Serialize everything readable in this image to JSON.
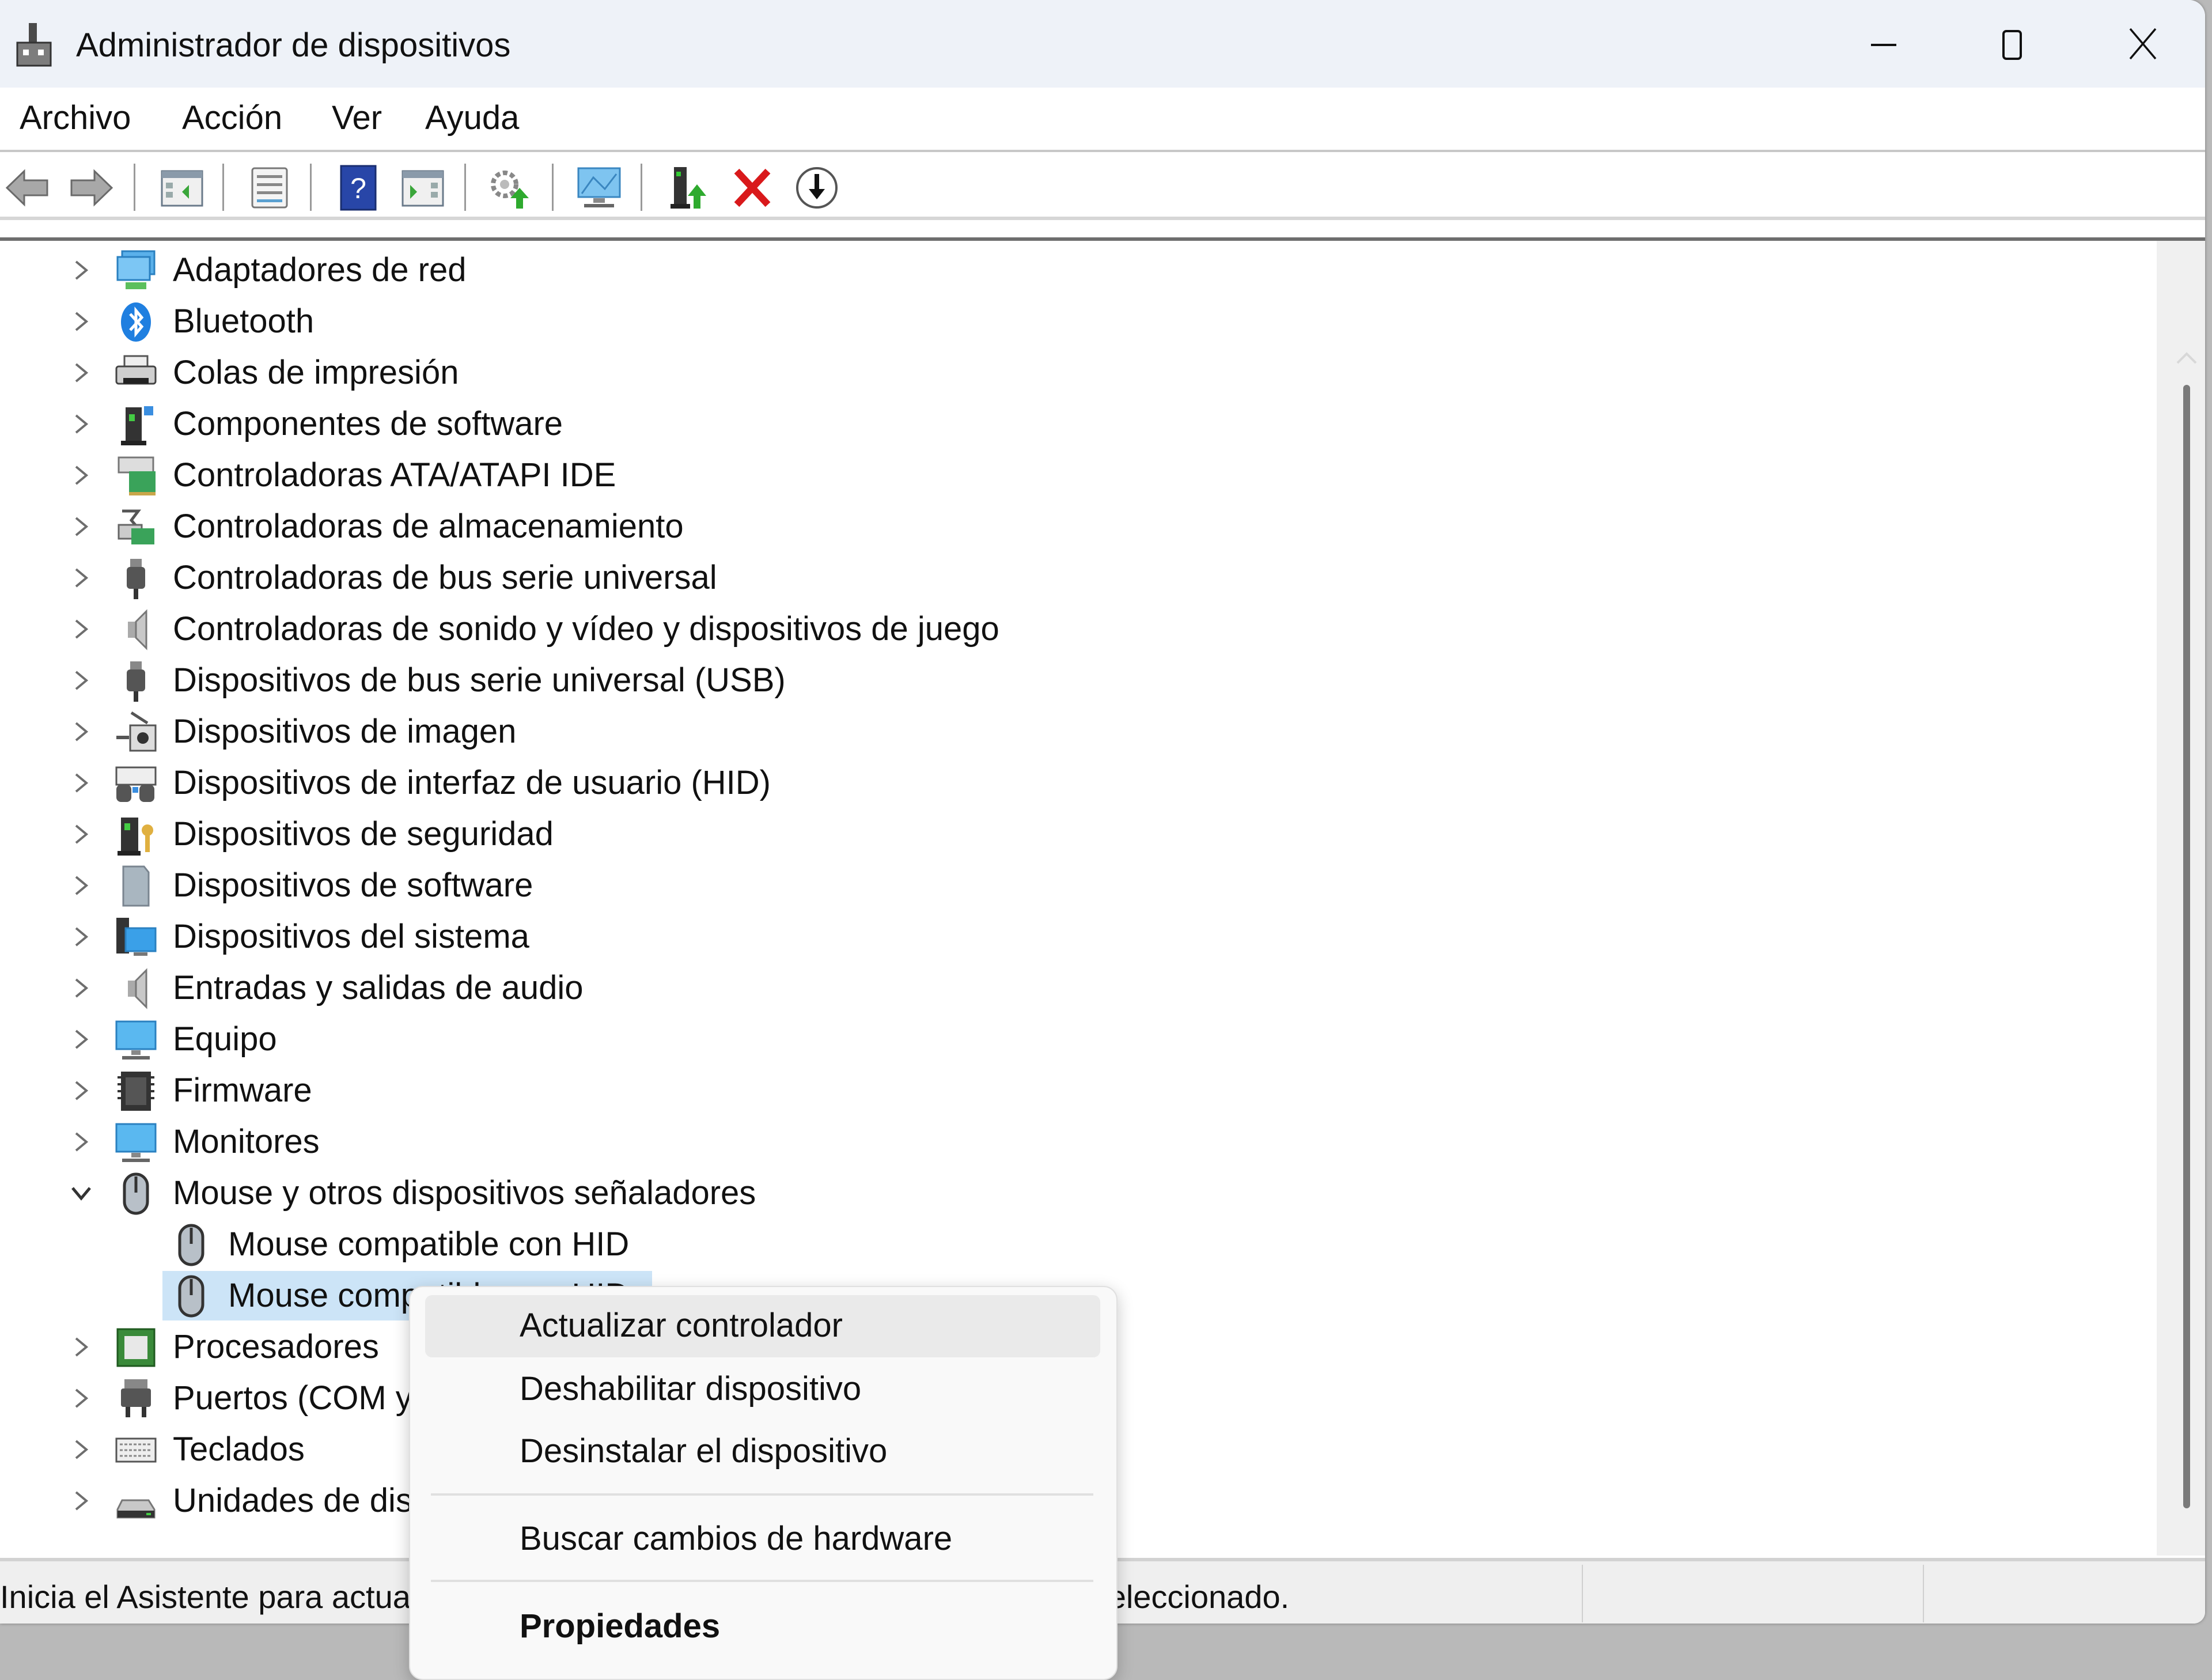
{
  "window": {
    "title": "Administrador de dispositivos",
    "controls": {
      "minimize": "minimize",
      "maximize": "maximize",
      "close": "close"
    }
  },
  "menubar": {
    "items": [
      {
        "label": "Archivo"
      },
      {
        "label": "Acción"
      },
      {
        "label": "Ver"
      },
      {
        "label": "Ayuda"
      }
    ]
  },
  "toolbar": {
    "buttons": [
      {
        "icon": "back-arrow-icon",
        "tooltip": "Atrás"
      },
      {
        "icon": "forward-arrow-icon",
        "tooltip": "Adelante"
      },
      {
        "icon": "show-hide-console-tree-icon"
      },
      {
        "icon": "properties-icon"
      },
      {
        "icon": "help-icon"
      },
      {
        "icon": "show-hide-action-pane-icon"
      },
      {
        "icon": "update-driver-icon"
      },
      {
        "icon": "scan-hardware-changes-icon"
      },
      {
        "icon": "add-legacy-hardware-icon"
      },
      {
        "icon": "uninstall-device-icon"
      },
      {
        "icon": "disable-device-icon"
      }
    ]
  },
  "tree": {
    "items": [
      {
        "label": "Adaptadores de red",
        "icon": "network-adapter-icon",
        "expanded": false
      },
      {
        "label": "Bluetooth",
        "icon": "bluetooth-icon",
        "expanded": false
      },
      {
        "label": "Colas de impresión",
        "icon": "printer-icon",
        "expanded": false
      },
      {
        "label": "Componentes de software",
        "icon": "software-component-icon",
        "expanded": false
      },
      {
        "label": "Controladoras ATA/ATAPI IDE",
        "icon": "ide-controller-icon",
        "expanded": false
      },
      {
        "label": "Controladoras de almacenamiento",
        "icon": "storage-controller-icon",
        "expanded": false
      },
      {
        "label": "Controladoras de bus serie universal",
        "icon": "usb-controller-icon",
        "expanded": false
      },
      {
        "label": "Controladoras de sonido y vídeo y dispositivos de juego",
        "icon": "speaker-icon",
        "expanded": false
      },
      {
        "label": "Dispositivos de bus serie universal (USB)",
        "icon": "usb-device-icon",
        "expanded": false
      },
      {
        "label": "Dispositivos de imagen",
        "icon": "camera-icon",
        "expanded": false
      },
      {
        "label": "Dispositivos de interfaz de usuario (HID)",
        "icon": "hid-icon",
        "expanded": false
      },
      {
        "label": "Dispositivos de seguridad",
        "icon": "security-device-icon",
        "expanded": false
      },
      {
        "label": "Dispositivos de software",
        "icon": "software-device-icon",
        "expanded": false
      },
      {
        "label": "Dispositivos del sistema",
        "icon": "system-device-icon",
        "expanded": false
      },
      {
        "label": "Entradas y salidas de audio",
        "icon": "audio-io-icon",
        "expanded": false
      },
      {
        "label": "Equipo",
        "icon": "computer-icon",
        "expanded": false
      },
      {
        "label": "Firmware",
        "icon": "firmware-chip-icon",
        "expanded": false
      },
      {
        "label": "Monitores",
        "icon": "monitor-icon",
        "expanded": false
      },
      {
        "label": "Mouse y otros dispositivos señaladores",
        "icon": "mouse-icon",
        "expanded": true,
        "children": [
          {
            "label": "Mouse compatible con HID",
            "icon": "mouse-icon",
            "selected": false
          },
          {
            "label": "Mouse compatible con HID",
            "icon": "mouse-icon",
            "selected": true
          }
        ]
      },
      {
        "label": "Procesadores",
        "icon": "processor-icon",
        "expanded": false
      },
      {
        "label": "Puertos (COM y LPT)",
        "icon": "port-icon",
        "expanded": false
      },
      {
        "label": "Teclados",
        "icon": "keyboard-icon",
        "expanded": false
      },
      {
        "label": "Unidades de disco",
        "icon": "disk-drive-icon",
        "expanded": false
      }
    ]
  },
  "statusbar": {
    "text": "Inicia el Asistente para actualizar software de controlador para el dispositivo seleccionado."
  },
  "context_menu": {
    "items": [
      {
        "label": "Actualizar controlador",
        "hover": true
      },
      {
        "label": "Deshabilitar dispositivo"
      },
      {
        "label": "Desinstalar el dispositivo"
      },
      {
        "type": "separator"
      },
      {
        "label": "Buscar cambios de hardware"
      },
      {
        "type": "separator"
      },
      {
        "label": "Propiedades",
        "bold": true
      }
    ]
  },
  "colors": {
    "selection": "#cce4f7",
    "titlebar": "#eef2f8",
    "delete_red": "#d9191b",
    "accent_blue": "#1e88e5"
  }
}
